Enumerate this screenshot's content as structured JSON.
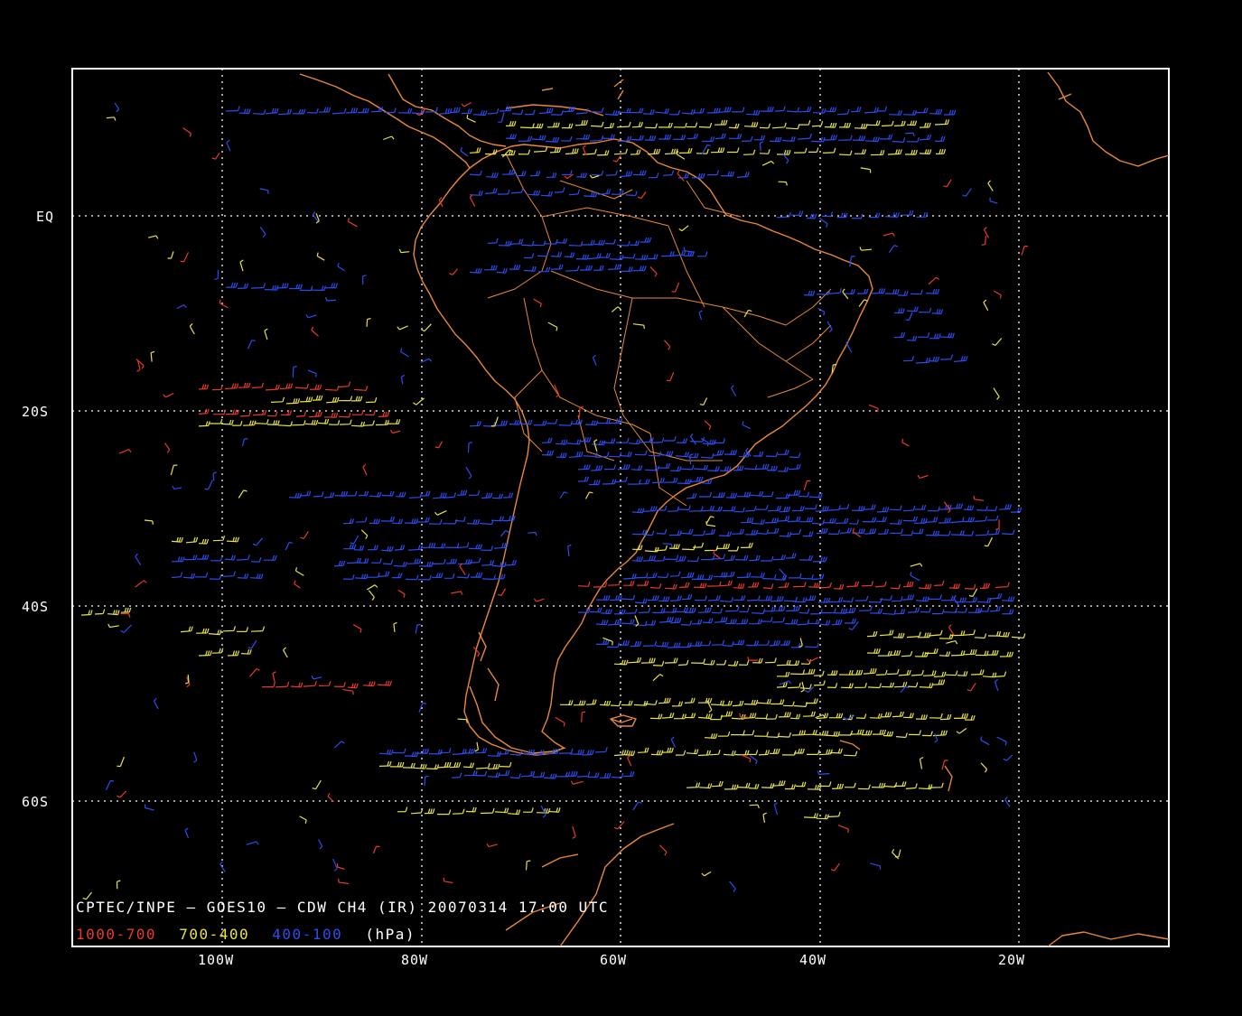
{
  "map": {
    "credit": "CPTEC/INPE — GOES10 — CDW CH4 (IR) 20070314 17:00 UTC",
    "legend": [
      {
        "text": "1000-700",
        "color": "#e83a2a"
      },
      {
        "text": "700-400",
        "color": "#e8e24a"
      },
      {
        "text": "400-100",
        "color": "#2d4cf0"
      },
      {
        "text": "(hPa)",
        "color": "#ffffff"
      }
    ],
    "lat_labels": [
      "EQ",
      "20S",
      "40S",
      "60S"
    ],
    "lon_labels": [
      "100W",
      "80W",
      "60W",
      "40W",
      "20W"
    ],
    "colors": {
      "background": "#000000",
      "frame": "#ffffff",
      "grid": "#ffffff",
      "coastline": "#e8883a",
      "low_level": "#e83a2a",
      "mid_level": "#e8e24a",
      "high_level": "#2d4cf0"
    }
  }
}
